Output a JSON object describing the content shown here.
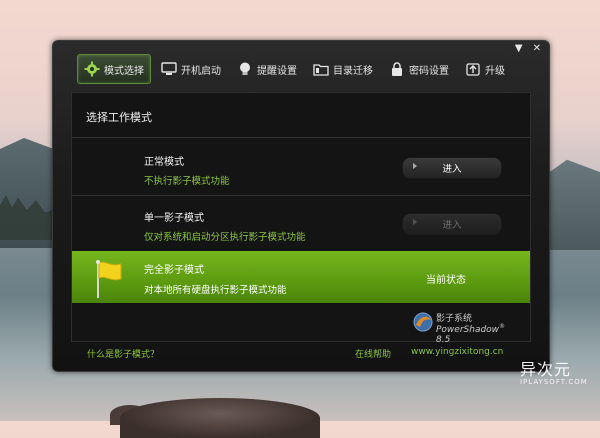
{
  "toolbar": {
    "items": [
      {
        "label": "模式选择",
        "icon": "gear-icon"
      },
      {
        "label": "开机启动",
        "icon": "monitor-icon"
      },
      {
        "label": "提醒设置",
        "icon": "bulb-icon"
      },
      {
        "label": "目录迁移",
        "icon": "folder-icon"
      },
      {
        "label": "密码设置",
        "icon": "lock-icon"
      },
      {
        "label": "升级",
        "icon": "upgrade-icon"
      }
    ]
  },
  "window_controls": {
    "pin": "▼",
    "close": "✕"
  },
  "panel": {
    "title": "选择工作模式",
    "modes": [
      {
        "title": "正常模式",
        "desc": "不执行影子模式功能",
        "button": "进入"
      },
      {
        "title": "单一影子模式",
        "desc": "仅对系统和启动分区执行影子模式功能",
        "button": "进入"
      },
      {
        "title": "完全影子模式",
        "desc": "对本地所有硬盘执行影子模式功能",
        "status": "当前状态"
      }
    ]
  },
  "brand": {
    "cn": "影子系统",
    "en": "PowerShadow",
    "version": "8.5",
    "reg": "®"
  },
  "footer": {
    "help_link": "什么是影子模式？",
    "online_help": "在线帮助",
    "website": "www.yingzixitong.cn"
  },
  "watermark": {
    "cn": "异次元",
    "en": "IPLAYSOFT.COM"
  },
  "colors": {
    "accent_green": "#8cc63f",
    "active_row": "#5c9a10"
  }
}
